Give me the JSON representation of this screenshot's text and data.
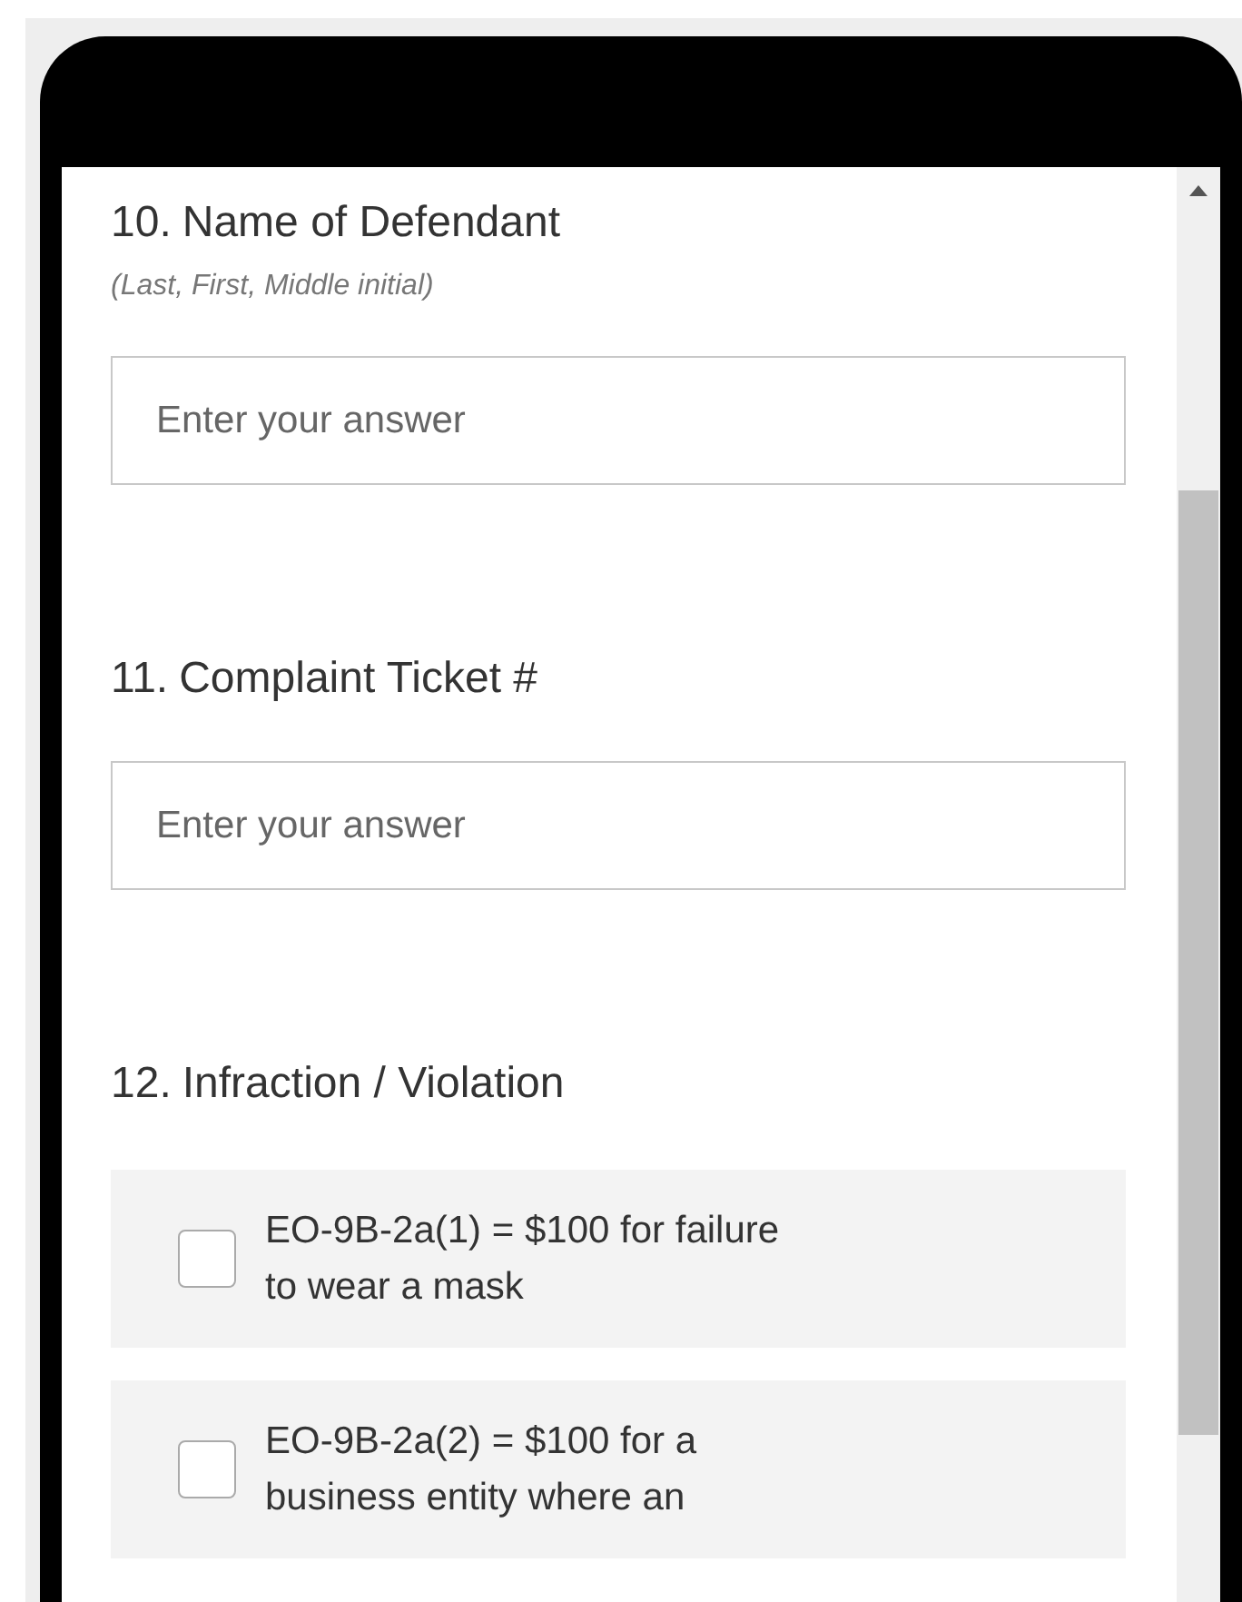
{
  "questions": [
    {
      "kind": "text",
      "number": "10.",
      "title": "Name of Defendant",
      "hint": "(Last, First, Middle initial)",
      "placeholder": "Enter your answer"
    },
    {
      "kind": "text",
      "number": "11.",
      "title": "Complaint Ticket #",
      "placeholder": "Enter your answer"
    },
    {
      "kind": "checkboxes",
      "number": "12.",
      "title": "Infraction / Violation",
      "options": [
        {
          "label": "EO-9B-2a(1) = $100 for failure to wear a mask",
          "checked": false
        },
        {
          "label": "EO-9B-2a(2) = $100 for a business entity where an",
          "checked": false
        }
      ]
    }
  ]
}
